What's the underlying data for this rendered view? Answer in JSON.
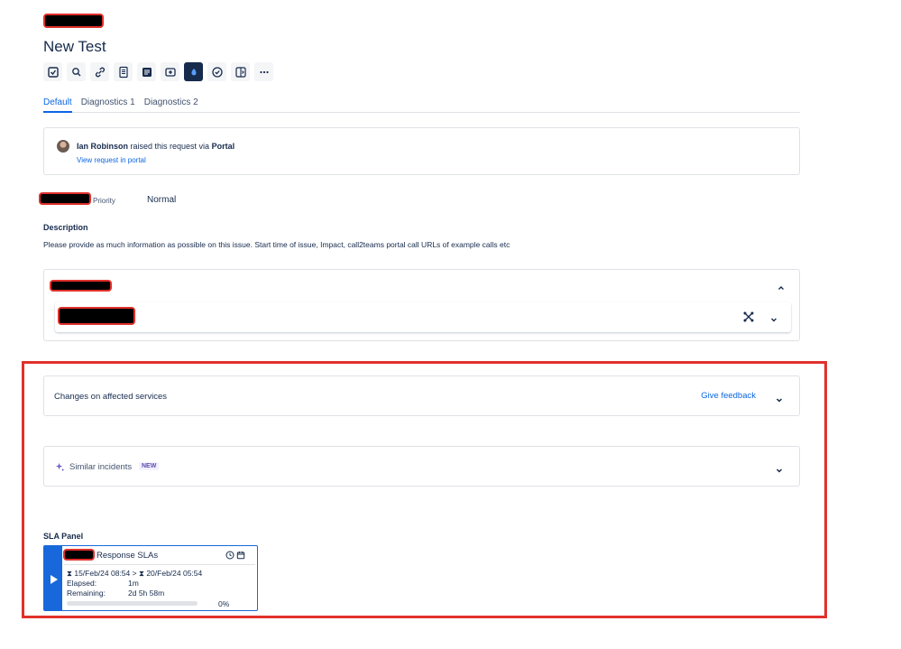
{
  "issue": {
    "title": "New Test"
  },
  "toolbar": {
    "items": [
      {
        "name": "checkbox-icon"
      },
      {
        "name": "search-icon"
      },
      {
        "name": "link-icon"
      },
      {
        "name": "document-icon"
      },
      {
        "name": "notes-icon"
      },
      {
        "name": "media-icon"
      },
      {
        "name": "app-dark-icon"
      },
      {
        "name": "check-circle-icon"
      },
      {
        "name": "split-panel-icon"
      },
      {
        "name": "more-icon"
      }
    ]
  },
  "tabs": [
    {
      "label": "Default",
      "active": true
    },
    {
      "label": "Diagnostics 1",
      "active": false
    },
    {
      "label": "Diagnostics 2",
      "active": false
    }
  ],
  "request": {
    "user": "Ian Robinson",
    "raised_text": "raised this request via",
    "channel": "Portal",
    "link": "View request in portal"
  },
  "priority": {
    "label": "Priority",
    "value": "Normal"
  },
  "description": {
    "label": "Description",
    "text": "Please provide as much information as possible on this issue. Start time of issue, Impact, call2teams portal call URLs of example calls etc"
  },
  "changes_panel": {
    "title": "Changes on affected services",
    "feedback": "Give feedback"
  },
  "similar_panel": {
    "title": "Similar incidents",
    "badge": "NEW"
  },
  "sla": {
    "label": "SLA Panel",
    "heading": "Response SLAs",
    "start": "15/Feb/24 08:54",
    "end": "20/Feb/24 05:54",
    "elapsed_label": "Elapsed:",
    "elapsed_value": "1m",
    "remaining_label": "Remaining:",
    "remaining_value": "2d 5h 58m",
    "progress_percent": 0,
    "percent_text": "0%"
  },
  "colors": {
    "accent": "#0c66e4",
    "sla_blue": "#1868db",
    "highlight_red": "#e0312b"
  }
}
